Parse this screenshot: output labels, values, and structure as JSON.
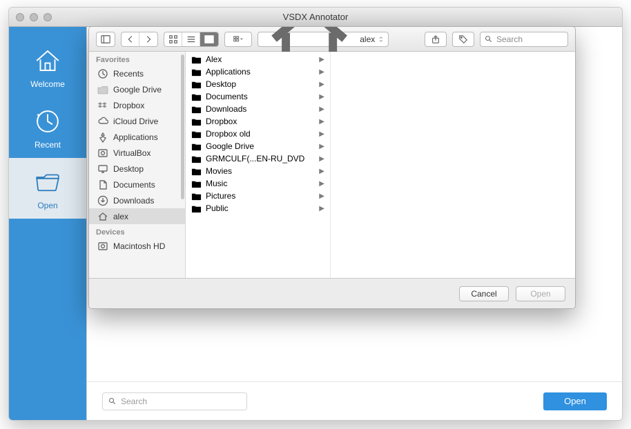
{
  "window": {
    "title": "VSDX Annotator"
  },
  "side_nav": {
    "welcome": "Welcome",
    "recent": "Recent",
    "open": "Open"
  },
  "main": {
    "search_placeholder": "Search",
    "open_button": "Open"
  },
  "dialog": {
    "path_label": "alex",
    "search_placeholder": "Search",
    "cancel": "Cancel",
    "open": "Open",
    "sidebar": {
      "favorites_header": "Favorites",
      "devices_header": "Devices",
      "favorites": [
        {
          "label": "Recents",
          "icon": "clock"
        },
        {
          "label": "Google Drive",
          "icon": "folder-gray"
        },
        {
          "label": "Dropbox",
          "icon": "dropbox"
        },
        {
          "label": "iCloud Drive",
          "icon": "cloud"
        },
        {
          "label": "Applications",
          "icon": "apps"
        },
        {
          "label": "VirtualBox",
          "icon": "disk"
        },
        {
          "label": "Desktop",
          "icon": "desktop"
        },
        {
          "label": "Documents",
          "icon": "doc"
        },
        {
          "label": "Downloads",
          "icon": "download"
        },
        {
          "label": "alex",
          "icon": "home",
          "selected": true
        }
      ],
      "devices": [
        {
          "label": "Macintosh HD",
          "icon": "disk"
        }
      ]
    },
    "column": [
      {
        "name": "Alex"
      },
      {
        "name": "Applications"
      },
      {
        "name": "Desktop"
      },
      {
        "name": "Documents"
      },
      {
        "name": "Downloads"
      },
      {
        "name": "Dropbox"
      },
      {
        "name": "Dropbox old"
      },
      {
        "name": "Google Drive"
      },
      {
        "name": "GRMCULF(...EN-RU_DVD"
      },
      {
        "name": "Movies"
      },
      {
        "name": "Music"
      },
      {
        "name": "Pictures"
      },
      {
        "name": "Public"
      }
    ]
  }
}
